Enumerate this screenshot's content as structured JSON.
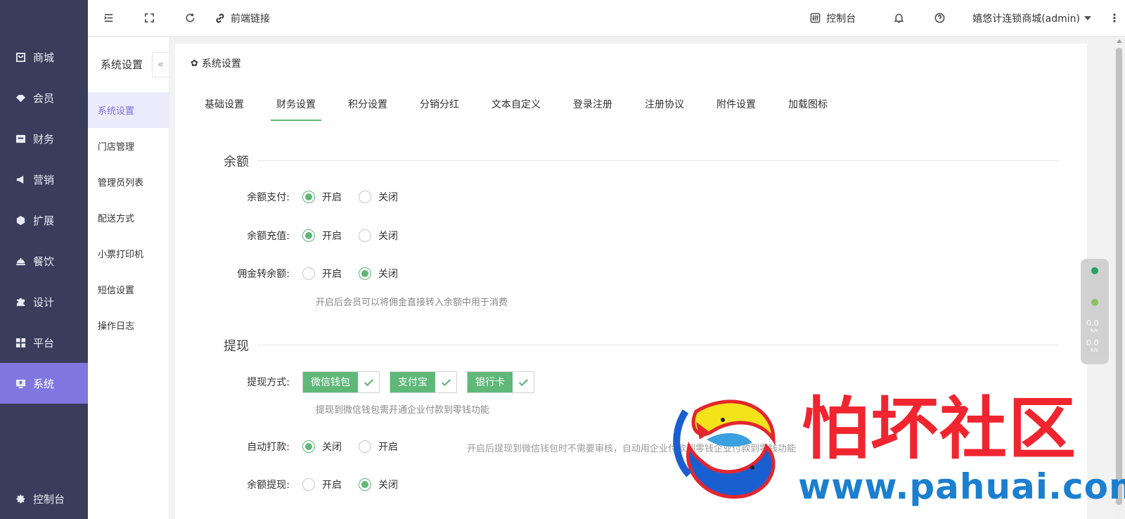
{
  "sidebar": {
    "items": [
      {
        "label": "商城",
        "icon": "shop-icon"
      },
      {
        "label": "会员",
        "icon": "member-icon"
      },
      {
        "label": "财务",
        "icon": "finance-icon"
      },
      {
        "label": "营销",
        "icon": "megaphone-icon"
      },
      {
        "label": "扩展",
        "icon": "cube-icon"
      },
      {
        "label": "餐饮",
        "icon": "dish-icon"
      },
      {
        "label": "设计",
        "icon": "puzzle-icon"
      },
      {
        "label": "平台",
        "icon": "grid-icon"
      },
      {
        "label": "系统",
        "icon": "system-icon"
      }
    ],
    "active_index": 8,
    "bottom_label": "控制台"
  },
  "header": {
    "frontend_link": "前端链接",
    "console": "控制台",
    "user": "嬉悠计连锁商城(admin)"
  },
  "subsidebar": {
    "title": "系统设置",
    "collapse": "«",
    "items": [
      "系统设置",
      "门店管理",
      "管理员列表",
      "配送方式",
      "小票打印机",
      "短信设置",
      "操作日志"
    ],
    "active_index": 0
  },
  "main": {
    "title": "系统设置",
    "tabs": [
      "基础设置",
      "财务设置",
      "积分设置",
      "分销分红",
      "文本自定义",
      "登录注册",
      "注册协议",
      "附件设置",
      "加载图标"
    ],
    "active_tab": 1,
    "balance": {
      "title": "余额",
      "balance_pay": {
        "label": "余额支付:",
        "options": [
          "开启",
          "关闭"
        ],
        "selected": "开启"
      },
      "balance_recharge": {
        "label": "余额充值:",
        "options": [
          "开启",
          "关闭"
        ],
        "selected": "开启"
      },
      "commission_to_balance": {
        "label": "佣金转余额:",
        "options": [
          "开启",
          "关闭"
        ],
        "selected": "关闭"
      },
      "hint": "开启后会员可以将佣金直接转入余额中用于消费"
    },
    "withdraw": {
      "title": "提现",
      "method": {
        "label": "提现方式:",
        "options": [
          "微信钱包",
          "支付宝",
          "银行卡"
        ]
      },
      "method_hint": "提现到微信钱包需开通企业付款到零钱功能",
      "auto_pay": {
        "label": "自动打款:",
        "options": [
          "关闭",
          "开启"
        ],
        "selected": "关闭"
      },
      "auto_pay_hint": "开启后提现到微信钱包时不需要审核，自动用企业付款到零钱企业付款到零钱功能",
      "balance_withdraw": {
        "label": "余额提现:",
        "options": [
          "开启",
          "关闭"
        ],
        "selected": "关闭"
      }
    }
  },
  "net_widget": {
    "up": "0.0",
    "down": "0.0",
    "unit": "K/s"
  },
  "watermark": {
    "title": "怕坏社区",
    "url": "www.pahuai.com"
  },
  "colors": {
    "sidebar_bg": "#393d5b",
    "active_purple": "#8076e0",
    "accent_green": "#5fb878"
  }
}
